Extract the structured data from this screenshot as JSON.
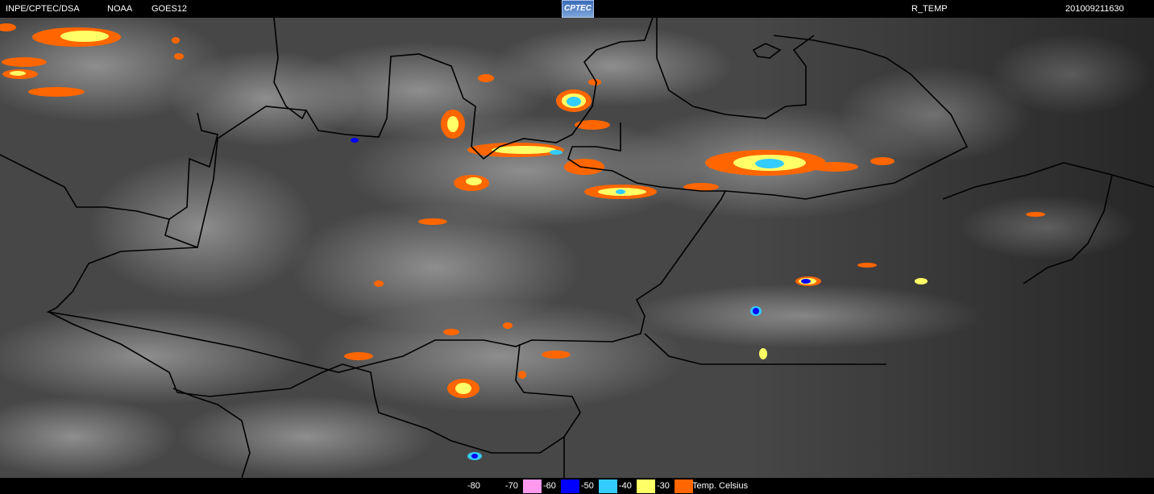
{
  "header": {
    "source": "INPE/CPTEC/DSA",
    "agency": "NOAA",
    "satellite": "GOES12",
    "logo_text": "CPTEC",
    "product": "R_TEMP",
    "timestamp": "201009211630"
  },
  "legend": {
    "bins": [
      {
        "label": "-80",
        "color": "#000000"
      },
      {
        "label": "-70",
        "color": "#ff99ee"
      },
      {
        "label": "-60",
        "color": "#0000ff"
      },
      {
        "label": "-50",
        "color": "#33ccff"
      },
      {
        "label": "-40",
        "color": "#ffff66"
      },
      {
        "label": "-30",
        "color": "#ff6600"
      }
    ],
    "unit": "Temp. Celsius"
  },
  "colors": {
    "background": "#404040",
    "cloud": "#b8b8b8",
    "border_lines": "#000000"
  }
}
